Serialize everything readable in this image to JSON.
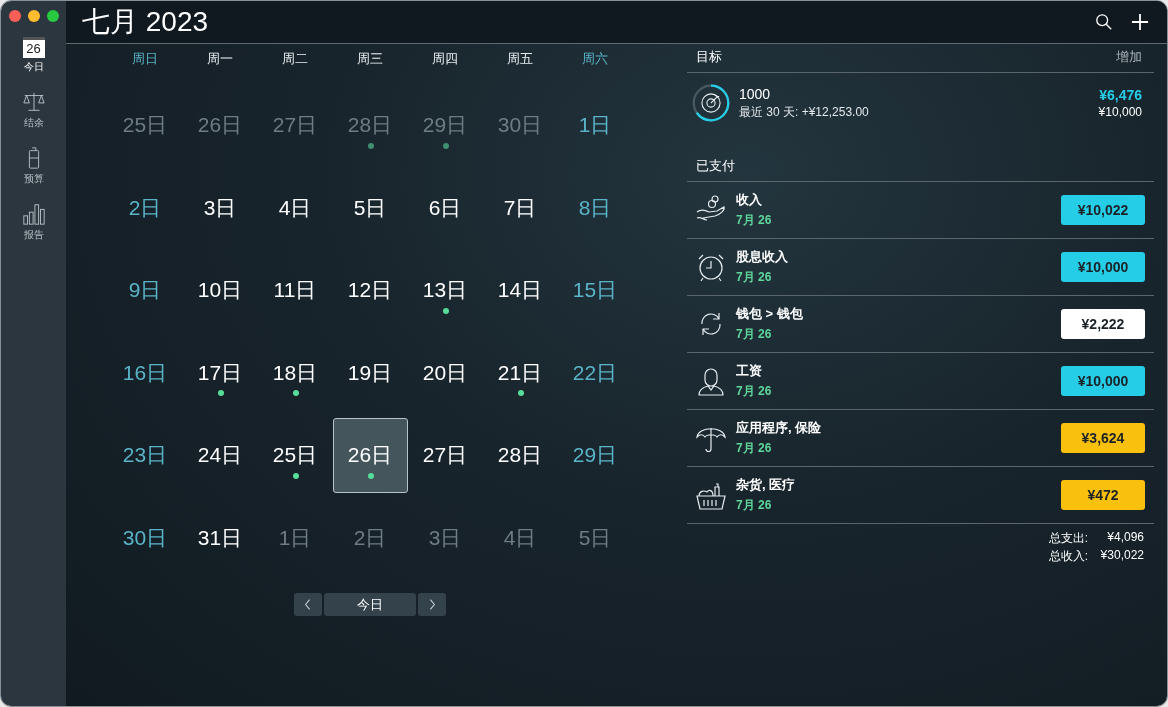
{
  "window": {
    "title": "七月 2023"
  },
  "sidebar": {
    "items": [
      {
        "label": "今日",
        "kind": "calendar",
        "icon_text": "26",
        "selected": true
      },
      {
        "label": "结余",
        "kind": "scale",
        "selected": false
      },
      {
        "label": "预算",
        "kind": "battery",
        "selected": false
      },
      {
        "label": "报告",
        "kind": "bars",
        "selected": false
      }
    ]
  },
  "calendar": {
    "weekdays": [
      {
        "label": "周日",
        "weekend": true
      },
      {
        "label": "周一",
        "weekend": false
      },
      {
        "label": "周二",
        "weekend": false
      },
      {
        "label": "周三",
        "weekend": false
      },
      {
        "label": "周四",
        "weekend": false
      },
      {
        "label": "周五",
        "weekend": false
      },
      {
        "label": "周六",
        "weekend": true
      }
    ],
    "days": [
      {
        "label": "25日",
        "kind": "other",
        "dot": false,
        "selected": false
      },
      {
        "label": "26日",
        "kind": "other",
        "dot": false,
        "selected": false
      },
      {
        "label": "27日",
        "kind": "other",
        "dot": false,
        "selected": false
      },
      {
        "label": "28日",
        "kind": "other",
        "dot": true,
        "selected": false
      },
      {
        "label": "29日",
        "kind": "other",
        "dot": true,
        "selected": false
      },
      {
        "label": "30日",
        "kind": "other",
        "dot": false,
        "selected": false
      },
      {
        "label": "1日",
        "kind": "current",
        "dot": false,
        "selected": false
      },
      {
        "label": "2日",
        "kind": "current",
        "dot": false,
        "selected": false
      },
      {
        "label": "3日",
        "kind": "current",
        "dot": false,
        "selected": false
      },
      {
        "label": "4日",
        "kind": "current",
        "dot": false,
        "selected": false
      },
      {
        "label": "5日",
        "kind": "current",
        "dot": false,
        "selected": false
      },
      {
        "label": "6日",
        "kind": "current",
        "dot": false,
        "selected": false
      },
      {
        "label": "7日",
        "kind": "current",
        "dot": false,
        "selected": false
      },
      {
        "label": "8日",
        "kind": "current",
        "dot": false,
        "selected": false
      },
      {
        "label": "9日",
        "kind": "current",
        "dot": false,
        "selected": false
      },
      {
        "label": "10日",
        "kind": "current",
        "dot": false,
        "selected": false
      },
      {
        "label": "11日",
        "kind": "current",
        "dot": false,
        "selected": false
      },
      {
        "label": "12日",
        "kind": "current",
        "dot": false,
        "selected": false
      },
      {
        "label": "13日",
        "kind": "current",
        "dot": true,
        "selected": false
      },
      {
        "label": "14日",
        "kind": "current",
        "dot": false,
        "selected": false
      },
      {
        "label": "15日",
        "kind": "current",
        "dot": false,
        "selected": false
      },
      {
        "label": "16日",
        "kind": "current",
        "dot": false,
        "selected": false
      },
      {
        "label": "17日",
        "kind": "current",
        "dot": true,
        "selected": false
      },
      {
        "label": "18日",
        "kind": "current",
        "dot": true,
        "selected": false
      },
      {
        "label": "19日",
        "kind": "current",
        "dot": false,
        "selected": false
      },
      {
        "label": "20日",
        "kind": "current",
        "dot": false,
        "selected": false
      },
      {
        "label": "21日",
        "kind": "current",
        "dot": true,
        "selected": false
      },
      {
        "label": "22日",
        "kind": "current",
        "dot": false,
        "selected": false
      },
      {
        "label": "23日",
        "kind": "current",
        "dot": false,
        "selected": false
      },
      {
        "label": "24日",
        "kind": "current",
        "dot": false,
        "selected": false
      },
      {
        "label": "25日",
        "kind": "current",
        "dot": true,
        "selected": false
      },
      {
        "label": "26日",
        "kind": "current",
        "dot": true,
        "selected": true
      },
      {
        "label": "27日",
        "kind": "current",
        "dot": false,
        "selected": false
      },
      {
        "label": "28日",
        "kind": "current",
        "dot": false,
        "selected": false
      },
      {
        "label": "29日",
        "kind": "current",
        "dot": false,
        "selected": false
      },
      {
        "label": "30日",
        "kind": "current",
        "dot": false,
        "selected": false
      },
      {
        "label": "31日",
        "kind": "current",
        "dot": false,
        "selected": false
      },
      {
        "label": "1日",
        "kind": "other",
        "dot": false,
        "selected": false
      },
      {
        "label": "2日",
        "kind": "other",
        "dot": false,
        "selected": false
      },
      {
        "label": "3日",
        "kind": "other",
        "dot": false,
        "selected": false
      },
      {
        "label": "4日",
        "kind": "other",
        "dot": false,
        "selected": false
      },
      {
        "label": "5日",
        "kind": "other",
        "dot": false,
        "selected": false
      }
    ],
    "today_button": "今日"
  },
  "goals": {
    "title": "目标",
    "add": "增加",
    "goal": {
      "name": "1000",
      "subtitle": "最近 30 天: +¥12,253.00",
      "saved": "¥6,476",
      "target": "¥10,000"
    }
  },
  "paid": {
    "title": "已支付",
    "items": [
      {
        "name": "收入",
        "date": "7月 26",
        "amount": "¥10,022",
        "color": "#26cde6",
        "kind": "hand"
      },
      {
        "name": "股息收入",
        "date": "7月 26",
        "amount": "¥10,000",
        "color": "#26cde6",
        "kind": "alarm"
      },
      {
        "name": "钱包 > 钱包",
        "date": "7月 26",
        "amount": "¥2,222",
        "color": "#ffffff",
        "kind": "cycle"
      },
      {
        "name": "工资",
        "date": "7月 26",
        "amount": "¥10,000",
        "color": "#26cde6",
        "kind": "person"
      },
      {
        "name": "应用程序, 保险",
        "date": "7月 26",
        "amount": "¥3,624",
        "color": "#fac00e",
        "kind": "umbrella"
      },
      {
        "name": "杂货, 医疗",
        "date": "7月 26",
        "amount": "¥472",
        "color": "#fac00e",
        "kind": "basket"
      }
    ],
    "totals": [
      {
        "label": "总支出:",
        "value": "¥4,096"
      },
      {
        "label": "总收入:",
        "value": "¥30,022"
      }
    ]
  }
}
